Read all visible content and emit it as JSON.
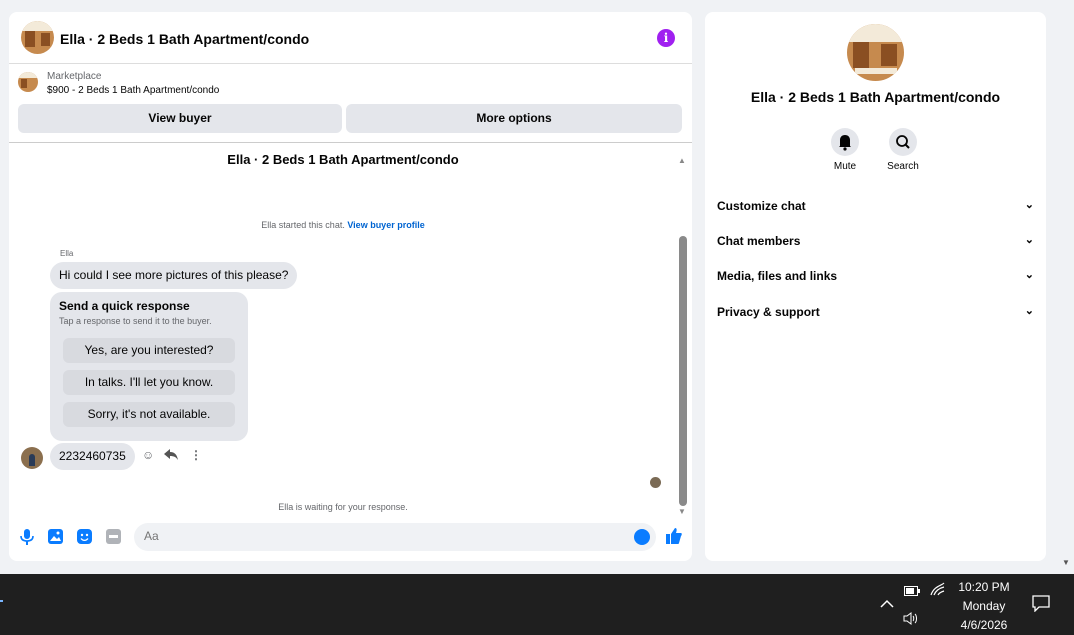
{
  "chat": {
    "title": "Ella · 2 Beds 1 Bath Apartment/condo",
    "marketplace_label": "Marketplace",
    "listing": "$900 - 2 Beds 1 Bath Apartment/condo",
    "view_buyer_label": "View buyer",
    "more_options_label": "More options",
    "conversation_title": "Ella · 2 Beds 1 Bath Apartment/condo",
    "started_text": "Ella started this chat.",
    "view_profile_label": "View buyer profile",
    "sender_name": "Ella",
    "message_1": "Hi could I see more pictures of this please?",
    "quick_response_title": "Send a quick response",
    "quick_response_subtitle": "Tap a response to send it to the buyer.",
    "quick_responses": [
      "Yes, are you interested?",
      "In talks. I'll let you know.",
      "Sorry, it's not available."
    ],
    "message_2": "2232460735",
    "waiting_text": "Ella is waiting for your response.",
    "input_placeholder": "Aa",
    "accent_color": "#a020f0",
    "link_color": "#0064d1"
  },
  "side": {
    "title": "Ella · 2 Beds 1 Bath Apartment/condo",
    "mute_label": "Mute",
    "search_label": "Search",
    "sections": [
      "Customize chat",
      "Chat members",
      "Media, files and links",
      "Privacy & support"
    ]
  },
  "taskbar": {
    "time": "10:20 PM",
    "day": "Monday",
    "date": "4/6/2026"
  }
}
